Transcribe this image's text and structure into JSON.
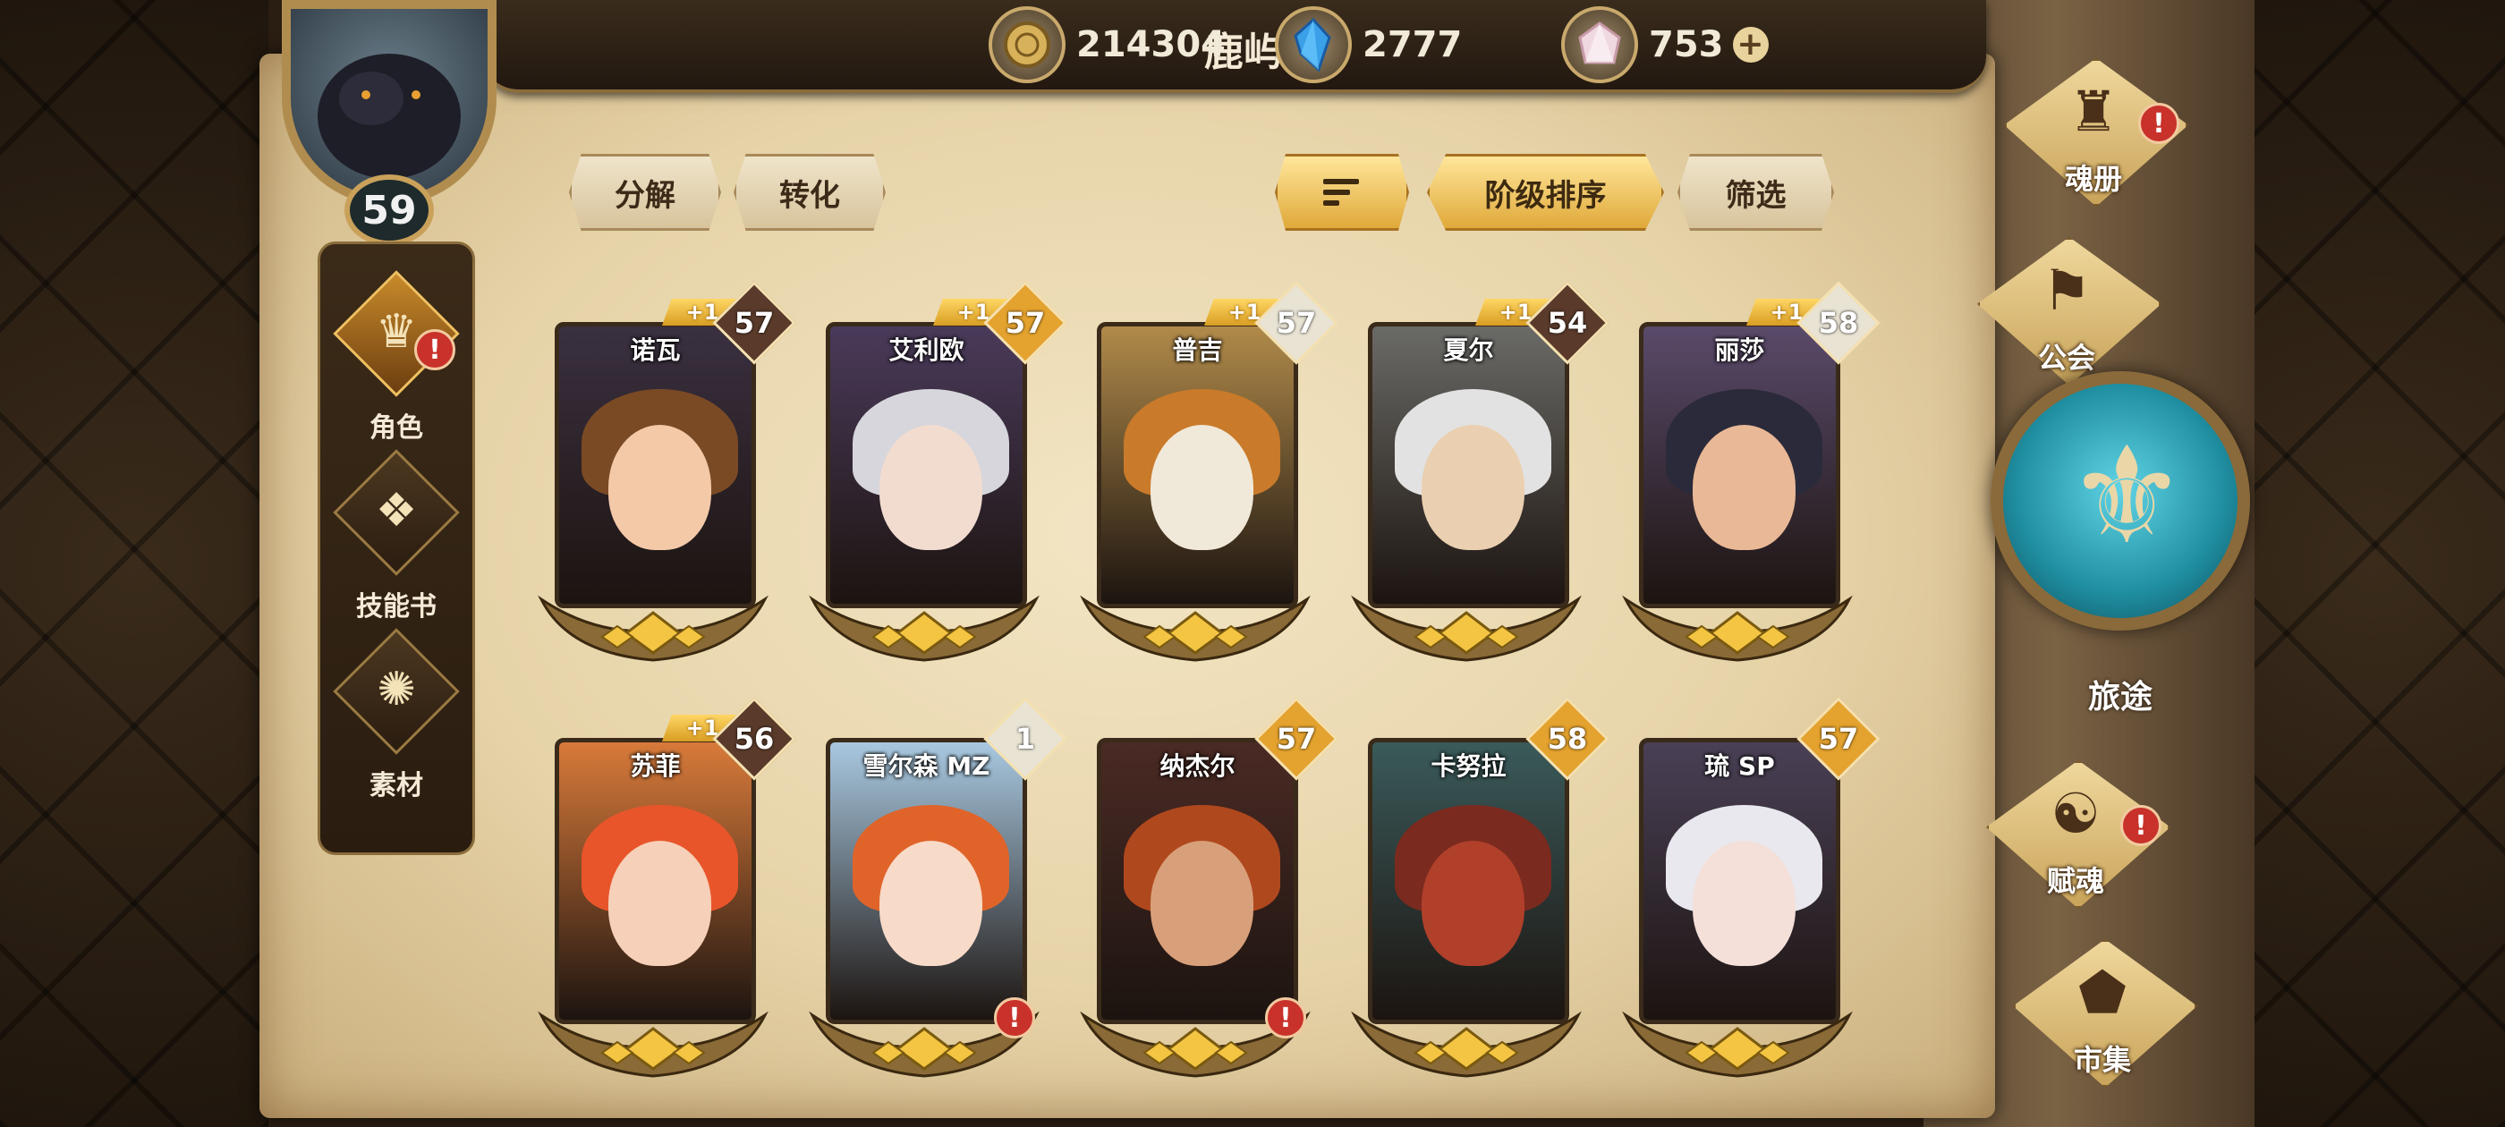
{
  "player": {
    "name": "鹿屿",
    "level": "59"
  },
  "resources": [
    {
      "icon": "gold-coin-icon",
      "value": "214304"
    },
    {
      "icon": "blue-crystal-icon",
      "value": "2777"
    },
    {
      "icon": "pink-gem-icon",
      "value": "753"
    }
  ],
  "side_nav": [
    {
      "label": "角色",
      "icon": "character-icon",
      "active": true,
      "alert": "!"
    },
    {
      "label": "技能书",
      "icon": "skill-book-icon",
      "active": false
    },
    {
      "label": "素材",
      "icon": "material-icon",
      "active": false
    }
  ],
  "toolbar": {
    "decompose": "分解",
    "convert": "转化",
    "sort_order": "阶级排序",
    "filter": "筛选"
  },
  "cards": [
    {
      "name": "诺瓦",
      "level": "57",
      "plus": "+1",
      "level_color": "#5a3a2a",
      "skin": "#f3c9a8",
      "hair": "#7a4a24",
      "bg": "#3a3040"
    },
    {
      "name": "艾利欧",
      "level": "57",
      "plus": "+1",
      "level_color": "#e4a22e",
      "skin": "#f2dcd0",
      "hair": "#d6d6dc",
      "bg": "#4a3a5a"
    },
    {
      "name": "普吉",
      "level": "57",
      "plus": "+1",
      "level_color": "#e9e3d4",
      "skin": "#f0e8d8",
      "hair": "#c97a2a",
      "bg": "#b08a4a"
    },
    {
      "name": "夏尔",
      "level": "54",
      "plus": "+1",
      "level_color": "#5a3a2a",
      "skin": "#ead0b0",
      "hair": "#e2e2e2",
      "bg": "#6a6a66"
    },
    {
      "name": "丽莎",
      "level": "58",
      "plus": "+1",
      "level_color": "#e9e3d4",
      "skin": "#e9b896",
      "hair": "#2a2a3a",
      "bg": "#5a4a6a"
    },
    {
      "name": "苏菲",
      "level": "56",
      "plus": "+1",
      "level_color": "#5a3a2a",
      "skin": "#f6d0b8",
      "hair": "#e8552a",
      "bg": "#d87a3a"
    },
    {
      "name": "雪尔森 MZ",
      "level": "1",
      "plus": "",
      "level_color": "#e9e3d4",
      "skin": "#f8dac8",
      "hair": "#e0642a",
      "bg": "#a8c8e0",
      "alert": "!"
    },
    {
      "name": "纳杰尔",
      "level": "57",
      "plus": "",
      "level_color": "#e4a22e",
      "skin": "#d8a07a",
      "hair": "#b0481e",
      "bg": "#4a2a24",
      "alert": "!"
    },
    {
      "name": "卡努拉",
      "level": "58",
      "plus": "",
      "level_color": "#e4a22e",
      "skin": "#b0402a",
      "hair": "#7a2a1e",
      "bg": "#3a5a5a"
    },
    {
      "name": "琉 SP",
      "level": "57",
      "plus": "",
      "level_color": "#e4a22e",
      "skin": "#f4e0d8",
      "hair": "#e8e8ee",
      "bg": "#4a4056"
    }
  ],
  "right_nav": [
    {
      "label": "魂册",
      "icon": "soul-book-icon",
      "alert": "!"
    },
    {
      "label": "公会",
      "icon": "guild-icon"
    },
    {
      "label": "旅途",
      "icon": "journey-emblem-icon"
    },
    {
      "label": "赋魂",
      "icon": "soul-infuse-icon",
      "alert": "!"
    },
    {
      "label": "市集",
      "icon": "market-icon"
    }
  ]
}
